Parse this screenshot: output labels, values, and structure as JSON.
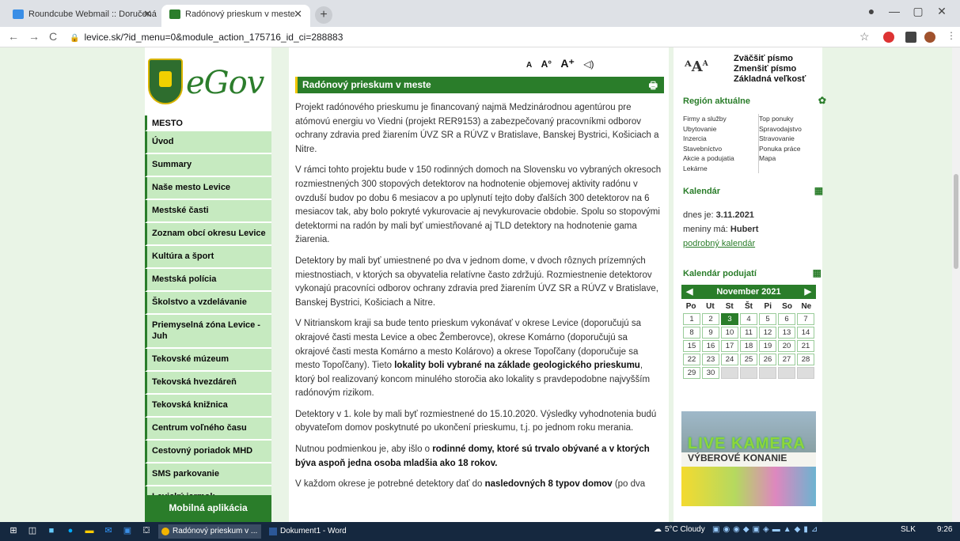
{
  "browser": {
    "tabs": [
      {
        "label": "Roundcube Webmail :: Doručená",
        "active": false,
        "favicon_color": "#3a8ee6"
      },
      {
        "label": "Radónový prieskum v meste",
        "active": true,
        "favicon_color": "#2a7d2a"
      }
    ],
    "new_tab": "+",
    "window_controls": [
      "—",
      "▢",
      "✕"
    ],
    "profile_dot": "●",
    "url": "levice.sk/?id_menu=0&module_action_175716_id_ci=288883",
    "nav": {
      "back": "←",
      "forward": "→",
      "reload": "C"
    },
    "star": "☆"
  },
  "site": {
    "logo_text": "eGov",
    "menu": [
      {
        "label": "MESTO",
        "kind": "head"
      },
      {
        "label": "Úvod"
      },
      {
        "label": "Summary"
      },
      {
        "label": "Naše mesto Levice"
      },
      {
        "label": "Mestské časti"
      },
      {
        "label": "Zoznam obcí okresu Levice"
      },
      {
        "label": "Kultúra a šport"
      },
      {
        "label": "Mestská polícia"
      },
      {
        "label": "Školstvo a vzdelávanie"
      },
      {
        "label": "Priemyselná zóna Levice - Juh",
        "kind": "tall"
      },
      {
        "label": "Tekovské múzeum"
      },
      {
        "label": "Tekovská hvezdáreň"
      },
      {
        "label": "Tekovská knižnica"
      },
      {
        "label": "Centrum voľného času"
      },
      {
        "label": "Cestovný poriadok MHD"
      },
      {
        "label": "SMS parkovanie"
      },
      {
        "label": "Levický jarmok"
      }
    ],
    "mobile_app": "Mobilná aplikácia"
  },
  "article": {
    "font_tools": [
      "A",
      "A°",
      "A⁺",
      "◁)"
    ],
    "title": "Radónový prieskum v meste",
    "print_icon": "🖶",
    "paragraphs": [
      {
        "text": "Projekt radónového prieskumu je financovaný najmä Medzinárodnou agentúrou pre atómovú energiu vo Viedni (projekt  RER9153) a zabezpečovaný pracovníkmi odborov ochrany zdravia pred žiarením ÚVZ SR a RÚVZ v Bratislave, Banskej Bystrici, Košiciach a Nitre."
      },
      {
        "text": "V rámci tohto projektu bude v 150 rodinných domoch na Slovensku vo vybraných okresoch rozmiestnených 300 stopových detektorov na hodnotenie objemovej aktivity radónu v ovzduší budov po dobu 6 mesiacov a po uplynutí tejto doby ďalších 300 detektorov na 6 mesiacov tak, aby bolo pokryté vykurovacie aj nevykurovacie obdobie. Spolu so stopovými detektormi na radón by mali byť umiestňované aj TLD detektory na hodnotenie gama žiarenia."
      },
      {
        "text": "Detektory by mali byť umiestnené po dva v jednom dome, v dvoch rôznych prízemných miestnostiach, v ktorých sa obyvatelia relatívne často zdržujú. Rozmiestnenie detektorov vykonajú pracovníci  odborov ochrany zdravia pred žiarením ÚVZ SR a RÚVZ v Bratislave, Banskej Bystrici, Košiciach a Nitre."
      },
      {
        "pre": "V Nitrianskom kraji sa bude tento prieskum vykonávať v okrese Levice (doporučujú sa okrajové časti mesta Levice a obec Žemberovce), okrese Komárno (doporučujú sa okrajové časti mesta Komárno a mesto Kolárovo) a okrese Topoľčany (doporučuje sa mesto Topoľčany). Tieto ",
        "bold": "lokality boli vybrané na základe geologického prieskumu",
        "post": ", ktorý bol realizovaný koncom minulého storočia ako lokality s pravdepodobne najvyšším radónovým rizikom."
      },
      {
        "text": "Detektory v 1. kole by mali byť rozmiestnené do 15.10.2020. Výsledky vyhodnotenia budú obyvateľom domov poskytnuté po ukončení prieskumu, t.j. po jednom roku merania."
      },
      {
        "pre": "Nutnou podmienkou je, aby išlo o ",
        "bold": "rodinné domy, ktoré sú trvalo obývané a v ktorých býva aspoň jedna osoba mladšia ako 18 rokov.",
        "post": ""
      },
      {
        "pre": "V každom okrese je potrebné detektory dať do ",
        "bold": "nasledovných 8 typov domov",
        "post": " (po dva"
      }
    ]
  },
  "sidebar": {
    "size_links": [
      "Zväčšiť písmo",
      "Zmenšiť písmo",
      "Základná veľkosť"
    ],
    "region_title": "Región aktuálne",
    "region_links_a": [
      "Firmy a služby",
      "Ubytovanie",
      "Inzercia",
      "Stavebníctvo",
      "Akcie a podujatia",
      "Lekárne"
    ],
    "region_links_b": [
      "Top ponuky",
      "Spravodajstvo",
      "Stravovanie",
      "Ponuka práce",
      "Mapa"
    ],
    "calendar_title": "Kalendár",
    "today_label": "dnes je: ",
    "today_date": "3.11.2021",
    "nameday_label": "meniny má: ",
    "nameday_name": "Hubert",
    "detail_link": "podrobný kalendár",
    "events_title": "Kalendár podujatí",
    "month_label": "November 2021",
    "dow": [
      "Po",
      "Ut",
      "St",
      "Št",
      "Pi",
      "So",
      "Ne"
    ],
    "days": [
      "1",
      "2",
      "3",
      "4",
      "5",
      "6",
      "7",
      "8",
      "9",
      "10",
      "11",
      "12",
      "13",
      "14",
      "15",
      "16",
      "17",
      "18",
      "19",
      "20",
      "21",
      "22",
      "23",
      "24",
      "25",
      "26",
      "27",
      "28",
      "29",
      "30",
      "",
      "",
      "",
      "",
      ""
    ],
    "today_day": "3",
    "camera_text": "LIVE KAMERA",
    "tender_text": "VÝBEROVÉ KONANIE"
  },
  "taskbar": {
    "apps": [
      {
        "label": "Radónový prieskum v ...",
        "active": true
      },
      {
        "label": "Dokument1 - Word",
        "active": false
      }
    ],
    "weather": "5°C Cloudy",
    "lang": "SLK",
    "time": "9:26"
  }
}
